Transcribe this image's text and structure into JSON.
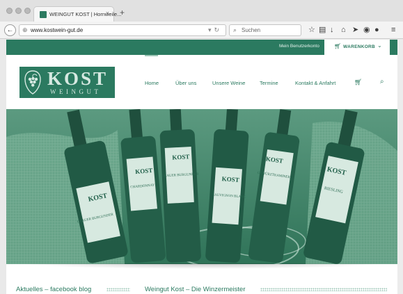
{
  "browser": {
    "tab_title": "WEINGUT KOST | Hornweile...",
    "tab_close": "×",
    "new_tab": "+",
    "url": "www.kostwein-gut.de",
    "search_placeholder": "Suchen"
  },
  "topbar": {
    "account_link": "Mein Benutzerkonto",
    "cart_label": "WARENKORB"
  },
  "logo": {
    "title": "KOST",
    "subtitle": "WEINGUT"
  },
  "nav": {
    "items": [
      "Home",
      "Über uns",
      "Unsere Weine",
      "Termine",
      "Kontakt & Anfahrt"
    ],
    "active": "Home"
  },
  "hero": {
    "bottle_labels": [
      "KOST",
      "KOST",
      "KOST",
      "KOST",
      "KOST",
      "KOST"
    ],
    "varieties": [
      "GRAUER BURGUNDER",
      "CHARDONNAY",
      "GRAUER BURGUNDER",
      "SAUVIGNON BLANC",
      "GEWÜRZTRAMINER",
      "RIESLING"
    ]
  },
  "sections": {
    "left_title": "Aktuelles – facebook blog",
    "right_title": "Weingut Kost – Die Winzermeister"
  },
  "colors": {
    "brand_green": "#2b7a60",
    "hero_tint": "#3a8467"
  }
}
